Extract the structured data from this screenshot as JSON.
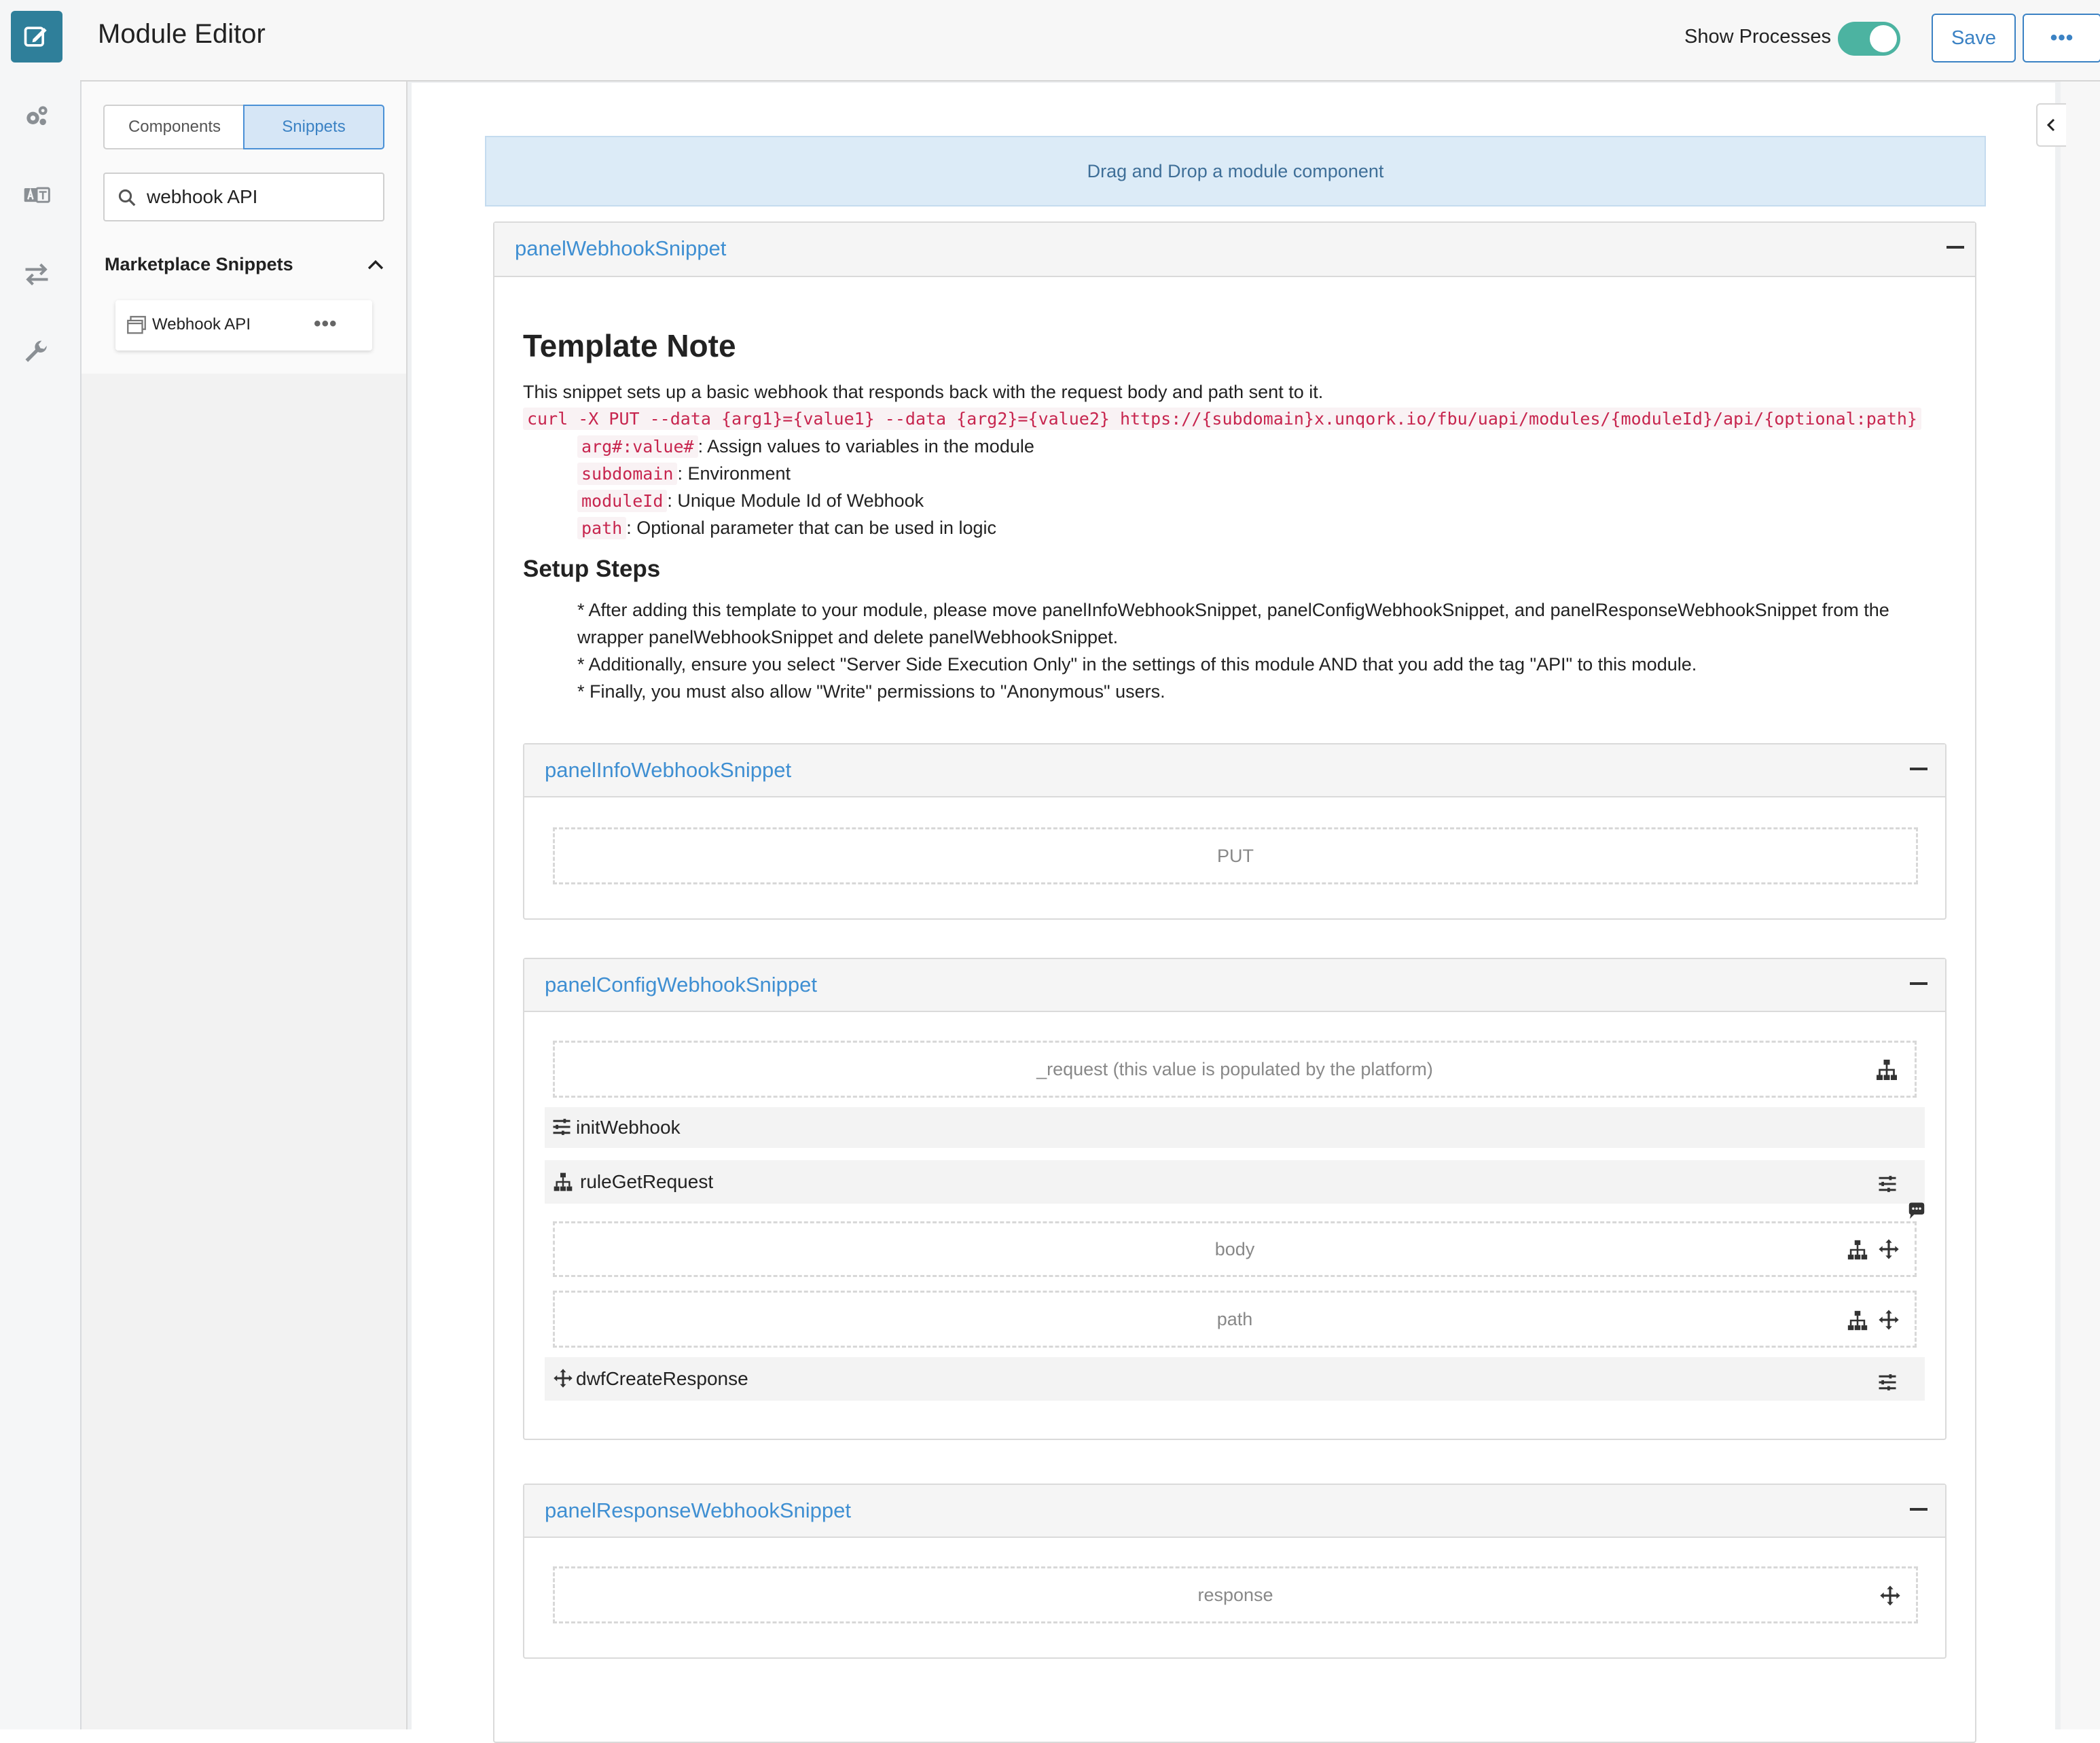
{
  "header": {
    "title": "Module Editor",
    "show_processes_label": "Show Processes",
    "save_label": "Save",
    "more_label": "•••"
  },
  "rail": {
    "icons": [
      "edit-icon",
      "gears-icon",
      "translate-icon",
      "transfer-icon",
      "wrench-icon"
    ],
    "accent": "#2f7f9a"
  },
  "sidebar": {
    "tabs": [
      {
        "label": "Components",
        "active": false
      },
      {
        "label": "Snippets",
        "active": true
      }
    ],
    "search": {
      "value": "webhook API"
    },
    "section_title": "Marketplace Snippets",
    "snippets": [
      {
        "label": "Webhook API",
        "more": "•••"
      }
    ]
  },
  "canvas": {
    "dropzone": "Drag and Drop a module component",
    "outer_panel": {
      "title": "panelWebhookSnippet",
      "note_title": "Template Note",
      "note_description": "This snippet sets up a basic webhook that responds back with the request body and path sent to it.",
      "curl": "curl -X PUT --data {arg1}={value1} --data {arg2}={value2} https://{subdomain}x.unqork.io/fbu/uapi/modules/{moduleId}/api/{optional:path}",
      "params": [
        {
          "code": "arg#:value#",
          "text": ": Assign values to variables in the module"
        },
        {
          "code": "subdomain",
          "text": ": Environment"
        },
        {
          "code": "moduleId",
          "text": ": Unique Module Id of Webhook"
        },
        {
          "code": "path",
          "text": ": Optional parameter that can be used in logic"
        }
      ],
      "setup_title": "Setup Steps",
      "steps": [
        "* After adding this template to your module, please move panelInfoWebhookSnippet, panelConfigWebhookSnippet, and panelResponseWebhookSnippet from the wrapper panelWebhookSnippet and delete panelWebhookSnippet.",
        "* Additionally, ensure you select \"Server Side Execution Only\" in the settings of this module AND that you add the tag \"API\" to this module.",
        "* Finally, you must also allow \"Write\" permissions to \"Anonymous\" users."
      ]
    },
    "info_panel": {
      "title": "panelInfoWebhookSnippet",
      "field": "PUT"
    },
    "config_panel": {
      "title": "panelConfigWebhookSnippet",
      "request_field": "_request (this value is populated by the platform)",
      "init_label": "initWebhook",
      "rule_label": "ruleGetRequest",
      "body_field": "body",
      "path_field": "path",
      "dwf_label": "dwfCreateResponse"
    },
    "response_panel": {
      "title": "panelResponseWebhookSnippet",
      "field": "response"
    }
  },
  "colors": {
    "link_blue": "#3f8fd2",
    "toggle_on": "#4cb3a1",
    "code_red": "#c7254e"
  }
}
